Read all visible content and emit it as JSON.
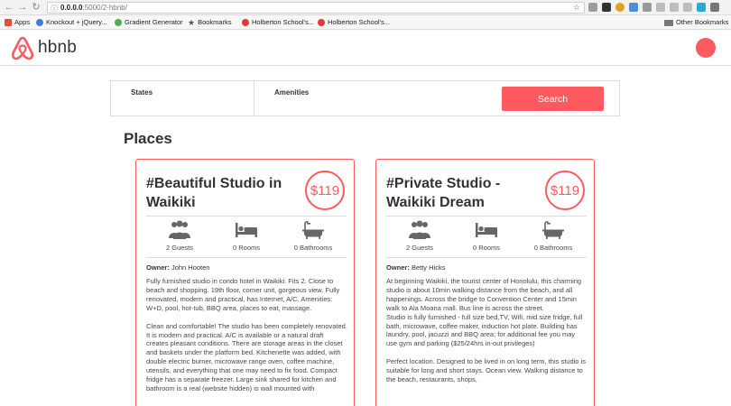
{
  "browser": {
    "url_host": "0.0.0.0",
    "url_path": ":5000/2-hbnb/",
    "bookmarks": [
      {
        "label": "Apps",
        "color": "#e74c3c"
      },
      {
        "label": "Knockout + jQuery...",
        "color": "#3b7dd8"
      },
      {
        "label": "Gradient Generator",
        "color": "#4caf50"
      },
      {
        "label": "Bookmarks",
        "color": "#555555"
      },
      {
        "label": "Holberton School's...",
        "color": "#e53935"
      },
      {
        "label": "Holberton School's...",
        "color": "#e53935"
      }
    ],
    "other_bookmarks": "Other Bookmarks"
  },
  "header": {
    "logo_text": "hbnb",
    "accent": "#ff5a5f"
  },
  "filters": {
    "states_label": "States",
    "amenities_label": "Amenities",
    "search_label": "Search"
  },
  "places": {
    "title": "Places",
    "items": [
      {
        "name": "#Beautiful Studio in Waikiki",
        "price": "$119",
        "guests": "2 Guests",
        "rooms": "0 Rooms",
        "bathrooms": "0 Bathrooms",
        "owner_label": "Owner:",
        "owner_name": "John Hooten",
        "description": [
          "Fully furnished studio in condo hotel in Waikiki. Fits 2. Close to beach and shopping. 19th floor, corner unit, gorgeous view. Fully renovated, modern and practical, has Internet, A/C. Amenities: W+D, pool, hot-tub, BBQ area, places to eat, massage.",
          "Clean and comfortable! The studio has been completely renovated. It is modern and practical. A/C is available or a natural draft creates pleasant conditions. There are storage areas in the closet and baskets under the platform bed. Kitchenette was added, with double electric burner, microwave range oven, coffee machine, utensils, and everything that one may need to fix food. Compact fridge has a separate freezer. Large sink shared for kitchen and bathroom is a real (website hidden) is wall mounted with"
        ]
      },
      {
        "name": "#Private Studio - Waikiki Dream",
        "price": "$119",
        "guests": "2 Guests",
        "rooms": "0 Rooms",
        "bathrooms": "0 Bathrooms",
        "owner_label": "Owner:",
        "owner_name": "Betty Hicks",
        "description": [
          "At beginning Waikiki, the tourist center of Honolulu, this charming studio is about 10min walking distance from the beach, and all happenings. Across the bridge to Convention Center and 15min walk to Ala Moana mall. Bus line is across the street.\nStudio is fully furnished - full size bed,TV, Wifi, mid size fridge, full bath, microwave, coffee maker, induction hot plate. Building has laundry, pool, jacuzzi and BBQ area; for additional fee you may use gym and parking ($25/24hrs in-out privileges)",
          "Perfect location. Designed to be lived in on long term, this studio is suitable for long and short stays. Ocean view. Walking distance to the beach, restaurants, shops,"
        ]
      }
    ]
  }
}
